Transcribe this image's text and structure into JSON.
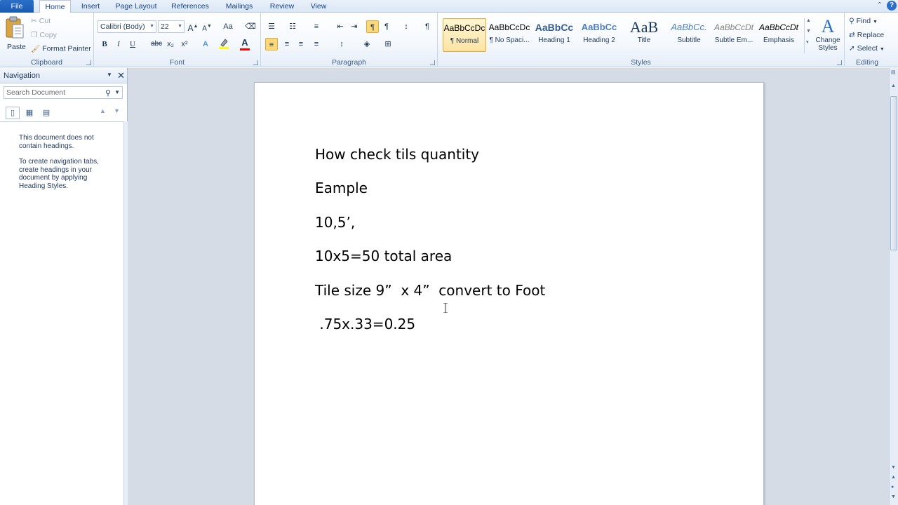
{
  "tabs": [
    {
      "label": "File"
    },
    {
      "label": "Home"
    },
    {
      "label": "Insert"
    },
    {
      "label": "Page Layout"
    },
    {
      "label": "References"
    },
    {
      "label": "Mailings"
    },
    {
      "label": "Review"
    },
    {
      "label": "View"
    }
  ],
  "clipboard": {
    "label": "Clipboard",
    "paste": "Paste",
    "cut": "Cut",
    "copy": "Copy",
    "format_painter": "Format Painter"
  },
  "font": {
    "label": "Font",
    "family": "Calibri (Body)",
    "size": "22",
    "bold": "B",
    "italic": "I",
    "underline": "U",
    "strike": "abc",
    "subscript": "x₂",
    "superscript": "x²",
    "grow": "A",
    "shrink": "A",
    "change_case": "Aa",
    "font_color_letter": "A",
    "highlight_color": "#ffff00",
    "font_color": "#ff0000"
  },
  "paragraph": {
    "label": "Paragraph",
    "pilcrow": "¶"
  },
  "styles": {
    "label": "Styles",
    "items": [
      {
        "sample": "AaBbCcDc",
        "name": "¶ Normal"
      },
      {
        "sample": "AaBbCcDc",
        "name": "¶ No Spaci..."
      },
      {
        "sample": "AaBbCc",
        "name": "Heading 1"
      },
      {
        "sample": "AaBbCc",
        "name": "Heading 2"
      },
      {
        "sample": "AaB",
        "name": "Title"
      },
      {
        "sample": "AaBbCc.",
        "name": "Subtitle"
      },
      {
        "sample": "AaBbCcDt",
        "name": "Subtle Em..."
      },
      {
        "sample": "AaBbCcDt",
        "name": "Emphasis"
      }
    ],
    "change_styles": "Change Styles"
  },
  "editing": {
    "label": "Editing",
    "find": "Find",
    "replace": "Replace",
    "select": "Select"
  },
  "navigation": {
    "title": "Navigation",
    "search_placeholder": "Search Document",
    "message1": "This document does not contain headings.",
    "message2": "To create navigation tabs, create headings in your document by applying Heading Styles."
  },
  "document": {
    "lines": [
      "How check tils quantity",
      "Eample",
      "10,5’,",
      "10x5=50 total area",
      "Tile size 9”  x 4”  convert to Foot",
      " .75x.33=0.25"
    ]
  }
}
